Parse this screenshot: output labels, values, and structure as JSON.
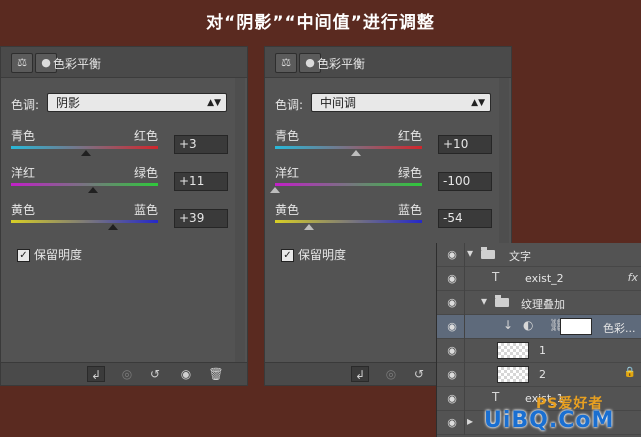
{
  "caption": "对“阴影”“中间值”进行调整",
  "panels": [
    {
      "title": "色彩平衡",
      "tone_label": "色调:",
      "tone_value": "阴影",
      "rows": [
        {
          "left": "青色",
          "right": "红色",
          "value": "+3",
          "position": 0.51,
          "gradient_left": "#29b8d8",
          "gradient_right": "#d0262c"
        },
        {
          "left": "洋红",
          "right": "绿色",
          "value": "+11",
          "position": 0.555,
          "gradient_left": "#c21fc8",
          "gradient_right": "#2ec93a"
        },
        {
          "left": "黄色",
          "right": "蓝色",
          "value": "+39",
          "position": 0.695,
          "gradient_left": "#d8cf25",
          "gradient_right": "#2528c9"
        }
      ],
      "preserve_label": "保留明度",
      "preserve_checked": true
    },
    {
      "title": "色彩平衡",
      "tone_label": "色调:",
      "tone_value": "中间调",
      "rows": [
        {
          "left": "青色",
          "right": "红色",
          "value": "+10",
          "position": 0.55,
          "gradient_left": "#29b8d8",
          "gradient_right": "#d0262c"
        },
        {
          "left": "洋红",
          "right": "绿色",
          "value": "-100",
          "position": 0.0,
          "gradient_left": "#c21fc8",
          "gradient_right": "#2ec93a"
        },
        {
          "left": "黄色",
          "right": "蓝色",
          "value": "-54",
          "position": 0.23,
          "gradient_left": "#d8cf25",
          "gradient_right": "#2528c9"
        }
      ],
      "preserve_label": "保留明度",
      "preserve_checked": true
    }
  ],
  "layers": [
    {
      "type": "group",
      "name": "文字"
    },
    {
      "type": "text",
      "name": "exist_2",
      "fx": "fx"
    },
    {
      "type": "group",
      "name": "纹理叠加"
    },
    {
      "type": "adjustment",
      "name": "色彩..."
    },
    {
      "type": "image",
      "name": "1"
    },
    {
      "type": "image",
      "name": "2"
    },
    {
      "type": "text",
      "name": "exist_1"
    }
  ],
  "watermark": {
    "text": "UiBQ.CoM",
    "badge": "PS爱好者"
  },
  "colors": {
    "background": "#5a2a20",
    "panel": "#535353",
    "selected_layer": "#5e6a7b"
  }
}
